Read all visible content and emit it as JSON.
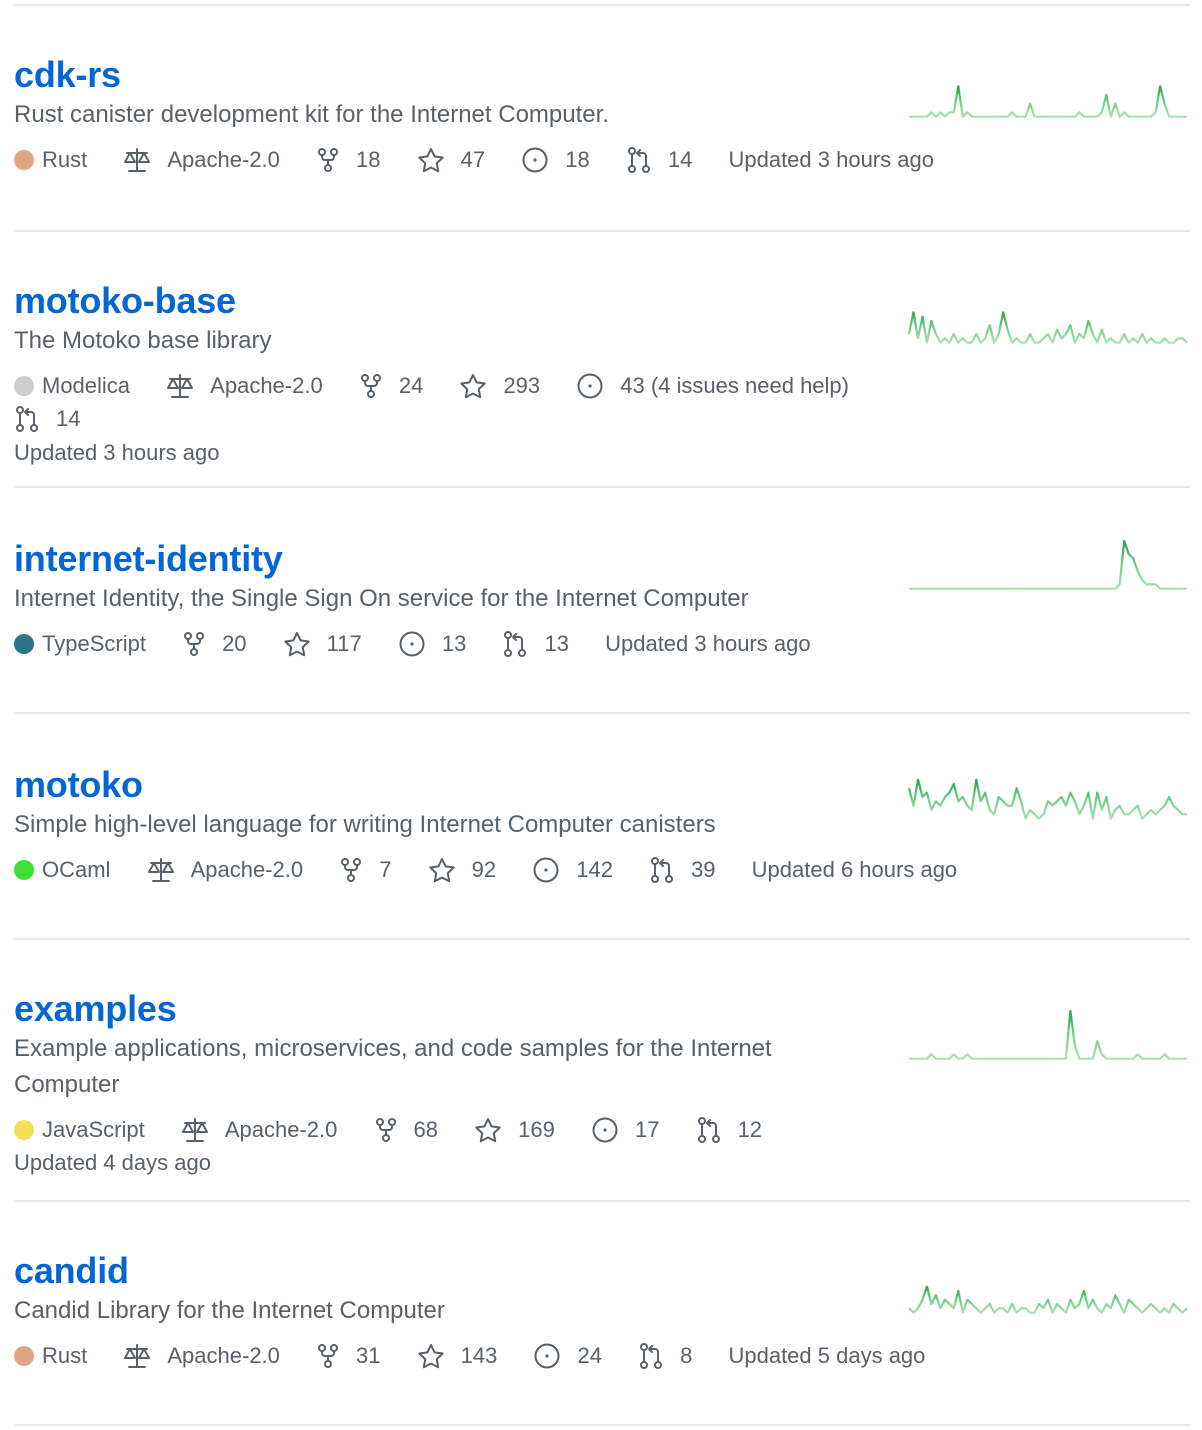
{
  "colors": {
    "link": "#0366d6",
    "muted": "#586069",
    "divider": "#e6e8eb",
    "spark_light": "#a8e3b0",
    "spark_dark": "#2ea44f"
  },
  "repos": [
    {
      "name": "cdk-rs",
      "description": "Rust canister development kit for the Internet Computer.",
      "language": "Rust",
      "language_color": "#dea584",
      "license": "Apache-2.0",
      "forks": "18",
      "stars": "47",
      "issues": "18",
      "pulls": "14",
      "updated": "Updated 3 hours ago",
      "activity": [
        1,
        1,
        1,
        1,
        1,
        2,
        1,
        2,
        1,
        2,
        2,
        8,
        1,
        2,
        1,
        1,
        1,
        1,
        1,
        1,
        1,
        1,
        1,
        2,
        1,
        1,
        1,
        4,
        1,
        1,
        1,
        1,
        1,
        1,
        1,
        1,
        1,
        1,
        2,
        1,
        1,
        1,
        1,
        2,
        6,
        1,
        4,
        1,
        2,
        1,
        1,
        1,
        1,
        1,
        1,
        2,
        8,
        4,
        1,
        1,
        1,
        1,
        1
      ]
    },
    {
      "name": "motoko-base",
      "description": "The Motoko base library",
      "language": "Modelica",
      "language_color": "#cccccc",
      "license": "Apache-2.0",
      "forks": "24",
      "stars": "293",
      "issues": "43 (4 issues need help)",
      "pulls": "14",
      "updated": "Updated 3 hours ago",
      "activity": [
        3,
        8,
        2,
        7,
        1,
        6,
        3,
        1,
        2,
        1,
        3,
        1,
        2,
        1,
        1,
        3,
        1,
        2,
        5,
        1,
        3,
        8,
        4,
        1,
        2,
        1,
        1,
        3,
        1,
        1,
        2,
        3,
        1,
        4,
        2,
        3,
        5,
        1,
        3,
        2,
        6,
        3,
        1,
        4,
        1,
        2,
        1,
        1,
        3,
        1,
        2,
        1,
        3,
        1,
        2,
        1,
        1,
        2,
        1,
        1,
        2,
        2,
        1
      ]
    },
    {
      "name": "internet-identity",
      "description": "Internet Identity, the Single Sign On service for the Internet Computer",
      "language": "TypeScript",
      "language_color": "#2b7489",
      "forks": "20",
      "stars": "117",
      "issues": "13",
      "pulls": "13",
      "updated": "Updated 3 hours ago",
      "activity": [
        1,
        1,
        1,
        1,
        1,
        1,
        1,
        1,
        1,
        1,
        1,
        1,
        1,
        1,
        1,
        1,
        1,
        1,
        1,
        1,
        1,
        1,
        1,
        1,
        1,
        1,
        1,
        1,
        1,
        1,
        1,
        1,
        1,
        1,
        1,
        1,
        1,
        1,
        1,
        1,
        1,
        1,
        1,
        1,
        1,
        1,
        1,
        2,
        12,
        9,
        8,
        5,
        3,
        2,
        2,
        2,
        1,
        1,
        1,
        1,
        1,
        1,
        1
      ]
    },
    {
      "name": "motoko",
      "description": "Simple high-level language for writing Internet Computer canisters",
      "language": "OCaml",
      "language_color": "#3be133",
      "license": "Apache-2.0",
      "forks": "7",
      "stars": "92",
      "issues": "142",
      "pulls": "39",
      "updated": "Updated 6 hours ago",
      "activity": [
        8,
        4,
        10,
        6,
        7,
        3,
        5,
        4,
        6,
        7,
        9,
        5,
        6,
        4,
        3,
        10,
        5,
        7,
        3,
        2,
        6,
        5,
        4,
        4,
        8,
        5,
        1,
        3,
        2,
        1,
        2,
        5,
        4,
        5,
        6,
        4,
        7,
        5,
        2,
        4,
        7,
        1,
        7,
        3,
        6,
        1,
        3,
        4,
        2,
        2,
        3,
        4,
        1,
        2,
        3,
        2,
        3,
        4,
        6,
        4,
        3,
        2,
        2
      ]
    },
    {
      "name": "examples",
      "description": "Example applications, microservices, and code samples for the Internet Computer",
      "language": "JavaScript",
      "language_color": "#f1e05a",
      "license": "Apache-2.0",
      "forks": "68",
      "stars": "169",
      "issues": "17",
      "pulls": "12",
      "updated": "Updated 4 days ago",
      "activity": [
        1,
        1,
        1,
        1,
        1,
        2,
        1,
        1,
        1,
        1,
        2,
        1,
        1,
        2,
        1,
        1,
        1,
        1,
        1,
        1,
        1,
        1,
        1,
        1,
        1,
        1,
        1,
        1,
        1,
        1,
        1,
        1,
        1,
        1,
        1,
        1,
        12,
        4,
        1,
        1,
        1,
        1,
        5,
        2,
        1,
        1,
        1,
        1,
        1,
        1,
        1,
        2,
        1,
        1,
        1,
        1,
        1,
        2,
        1,
        1,
        1,
        1,
        1
      ]
    },
    {
      "name": "candid",
      "description": "Candid Library for the Internet Computer",
      "language": "Rust",
      "language_color": "#dea584",
      "license": "Apache-2.0",
      "forks": "31",
      "stars": "143",
      "issues": "24",
      "pulls": "8",
      "updated": "Updated 5 days ago",
      "activity": [
        2,
        1,
        2,
        4,
        7,
        3,
        5,
        2,
        4,
        3,
        2,
        6,
        1,
        4,
        3,
        2,
        1,
        2,
        3,
        1,
        2,
        2,
        1,
        3,
        1,
        2,
        2,
        1,
        1,
        3,
        2,
        4,
        1,
        3,
        2,
        1,
        4,
        2,
        3,
        6,
        2,
        4,
        2,
        1,
        3,
        2,
        5,
        3,
        1,
        4,
        3,
        2,
        1,
        2,
        3,
        2,
        1,
        2,
        1,
        3,
        2,
        1,
        2
      ]
    }
  ]
}
